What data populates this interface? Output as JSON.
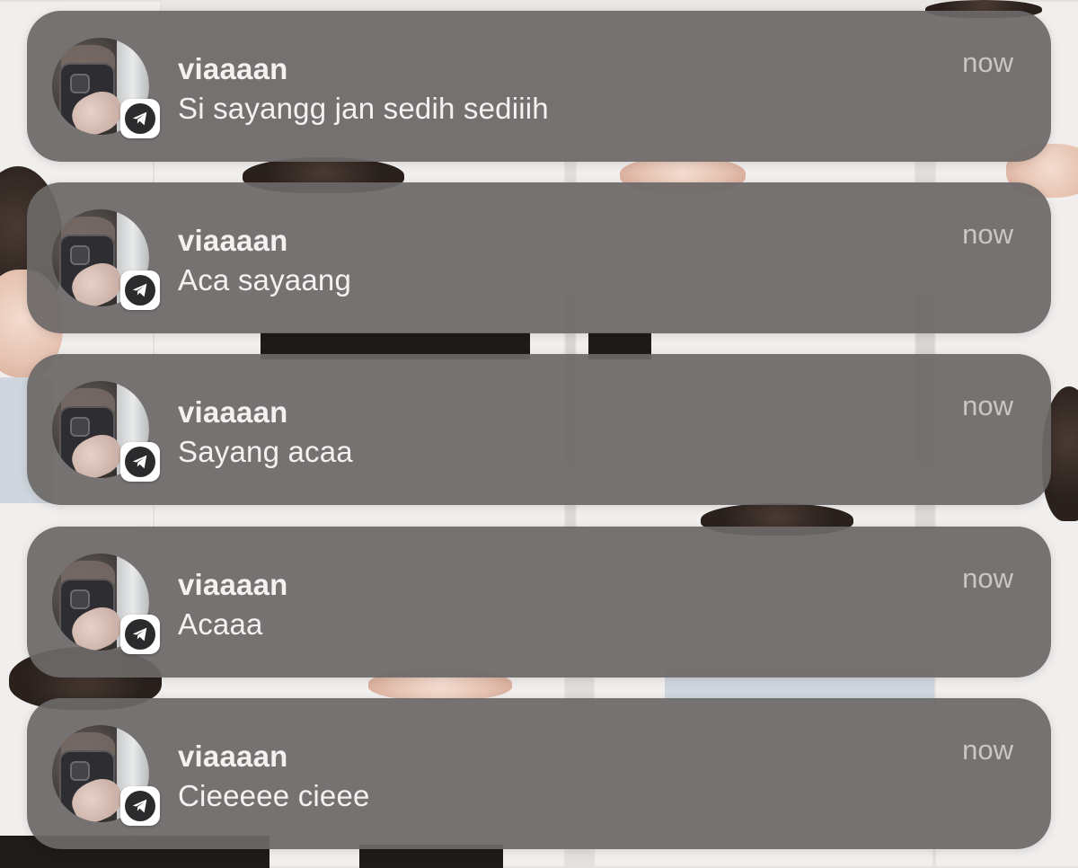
{
  "notifications": [
    {
      "sender": "viaaaan",
      "message": "Si sayangg jan sedih sediiih",
      "time": "now"
    },
    {
      "sender": "viaaaan",
      "message": "Aca sayaang",
      "time": "now"
    },
    {
      "sender": "viaaaan",
      "message": "Sayang acaa",
      "time": "now"
    },
    {
      "sender": "viaaaan",
      "message": "Acaaa",
      "time": "now"
    },
    {
      "sender": "viaaaan",
      "message": "Cieeeee cieee",
      "time": "now"
    }
  ],
  "app_icon": "telegram-icon",
  "colors": {
    "card_background": "#6c6867",
    "primary_text": "#f4f2f1",
    "secondary_text": "#c9c6c4"
  }
}
